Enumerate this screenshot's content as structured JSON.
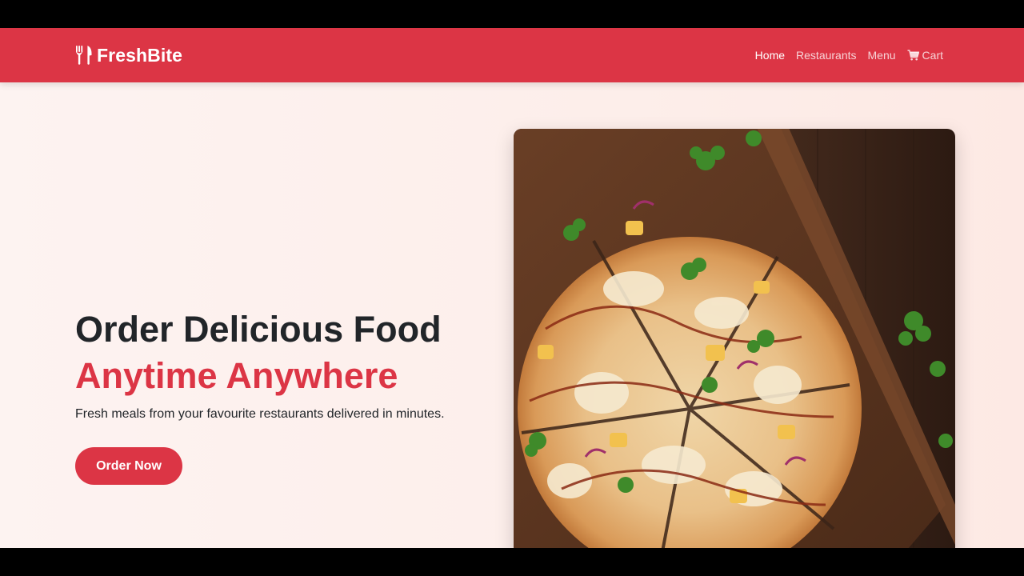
{
  "navbar": {
    "brand": {
      "name": "FreshBite",
      "icon": "utensils-icon"
    },
    "links": [
      {
        "label": "Home",
        "active": true
      },
      {
        "label": "Restaurants",
        "active": false
      },
      {
        "label": "Menu",
        "active": false
      },
      {
        "label": "Cart",
        "active": false,
        "icon": "cart-icon"
      }
    ]
  },
  "hero": {
    "title_line1": "Order Delicious Food",
    "title_line2": "Anytime Anywhere",
    "subtitle": "Fresh meals from your favourite restaurants delivered in minutes.",
    "cta_label": "Order Now",
    "image": "pizza-photo"
  },
  "colors": {
    "primary": "#dc3545",
    "text_dark": "#212529",
    "hero_bg": "#fdf0ec"
  }
}
